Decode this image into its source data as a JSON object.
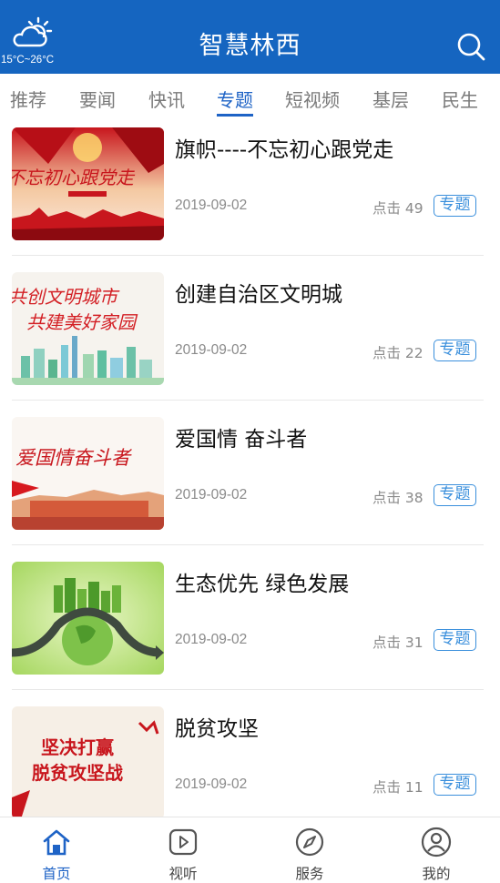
{
  "header": {
    "title": "智慧林西",
    "weather": {
      "icon": "partly-cloudy-icon",
      "temperature": "15°C~26°C"
    },
    "search_icon": "search-icon"
  },
  "tabs": [
    {
      "label": "推荐",
      "active": false
    },
    {
      "label": "要闻",
      "active": false
    },
    {
      "label": "快讯",
      "active": false
    },
    {
      "label": "专题",
      "active": true
    },
    {
      "label": "短视频",
      "active": false
    },
    {
      "label": "基层",
      "active": false
    },
    {
      "label": "民生",
      "active": false
    }
  ],
  "articles": [
    {
      "title": "旗帜----不忘初心跟党走",
      "date": "2019-09-02",
      "hits": "点击 49",
      "tag": "专题",
      "thumb_text": "不忘初心跟党走"
    },
    {
      "title": "创建自治区文明城",
      "date": "2019-09-02",
      "hits": "点击 22",
      "tag": "专题",
      "thumb_text": [
        "共创文明城市",
        "共建美好家园"
      ]
    },
    {
      "title": "爱国情 奋斗者",
      "date": "2019-09-02",
      "hits": "点击 38",
      "tag": "专题",
      "thumb_text": "爱国情奋斗者"
    },
    {
      "title": "生态优先 绿色发展",
      "date": "2019-09-02",
      "hits": "点击 31",
      "tag": "专题"
    },
    {
      "title": "脱贫攻坚",
      "date": "2019-09-02",
      "hits": "点击 11",
      "tag": "专题",
      "thumb_text": [
        "坚决打赢",
        "脱贫攻坚战"
      ]
    }
  ],
  "bottom_nav": [
    {
      "label": "首页",
      "icon": "home-icon",
      "active": true
    },
    {
      "label": "视听",
      "icon": "play-icon",
      "active": false
    },
    {
      "label": "服务",
      "icon": "compass-icon",
      "active": false
    },
    {
      "label": "我的",
      "icon": "user-icon",
      "active": false
    }
  ],
  "colors": {
    "header": "#1565c0",
    "accent": "#1e63c6",
    "tag": "#3a8fdc"
  }
}
